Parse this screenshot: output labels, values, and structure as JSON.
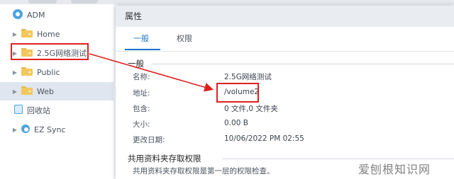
{
  "tree": {
    "root_label": "ADM",
    "items": [
      {
        "label": "Home"
      },
      {
        "label": "2.5G网络测试"
      },
      {
        "label": "Public"
      },
      {
        "label": "Web"
      }
    ],
    "recycle_label": "回收站",
    "ez_sync_label": "EZ Sync"
  },
  "panel": {
    "title": "属性",
    "tabs": [
      "一般",
      "权限"
    ],
    "general_section": "一般",
    "fields": [
      {
        "label": "名称:",
        "value": "2.5G网络测试"
      },
      {
        "label": "地址:",
        "value": "/volume2"
      },
      {
        "label": "包含:",
        "value": "0 文件,0 文件夹"
      },
      {
        "label": "大小:",
        "value": "0.00 B"
      },
      {
        "label": "更改日期:",
        "value": "10/06/2022 PM 02:55"
      }
    ],
    "share_section": "共用资料夹存取权限",
    "share_note": "共用资料夹存取权限是第一层的权限检查。"
  },
  "watermark": "爱刨根知识网",
  "colors": {
    "accent": "#1a73c9",
    "highlight": "#e02020",
    "folder": "#f2c75c"
  }
}
